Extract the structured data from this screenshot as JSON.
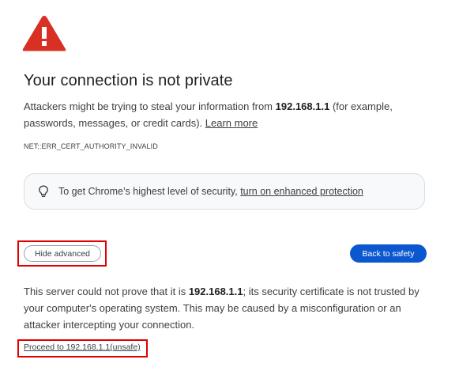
{
  "warning": {
    "icon": "warning-triangle-icon",
    "color": "#d93025"
  },
  "title": "Your connection is not private",
  "description": {
    "prefix": "Attackers might be trying to steal your information from ",
    "host": "192.168.1.1",
    "suffix": " (for example, passwords, messages, or credit cards). ",
    "learn_more": "Learn more"
  },
  "error_code": "NET::ERR_CERT_AUTHORITY_INVALID",
  "security_box": {
    "icon": "lightbulb-icon",
    "text": "To get Chrome’s highest level of security, ",
    "link": "turn on enhanced protection"
  },
  "buttons": {
    "hide_advanced": "Hide advanced",
    "back_to_safety": "Back to safety",
    "back_color": "#0b57d0"
  },
  "details": {
    "prefix": "This server could not prove that it is ",
    "host": "192.168.1.1",
    "suffix": "; its security certificate is not trusted by your computer's operating system. This may be caused by a misconfiguration or an attacker intercepting your connection."
  },
  "proceed_link": "Proceed to 192.168.1.1(unsafe)",
  "highlight_color": "#e00000"
}
